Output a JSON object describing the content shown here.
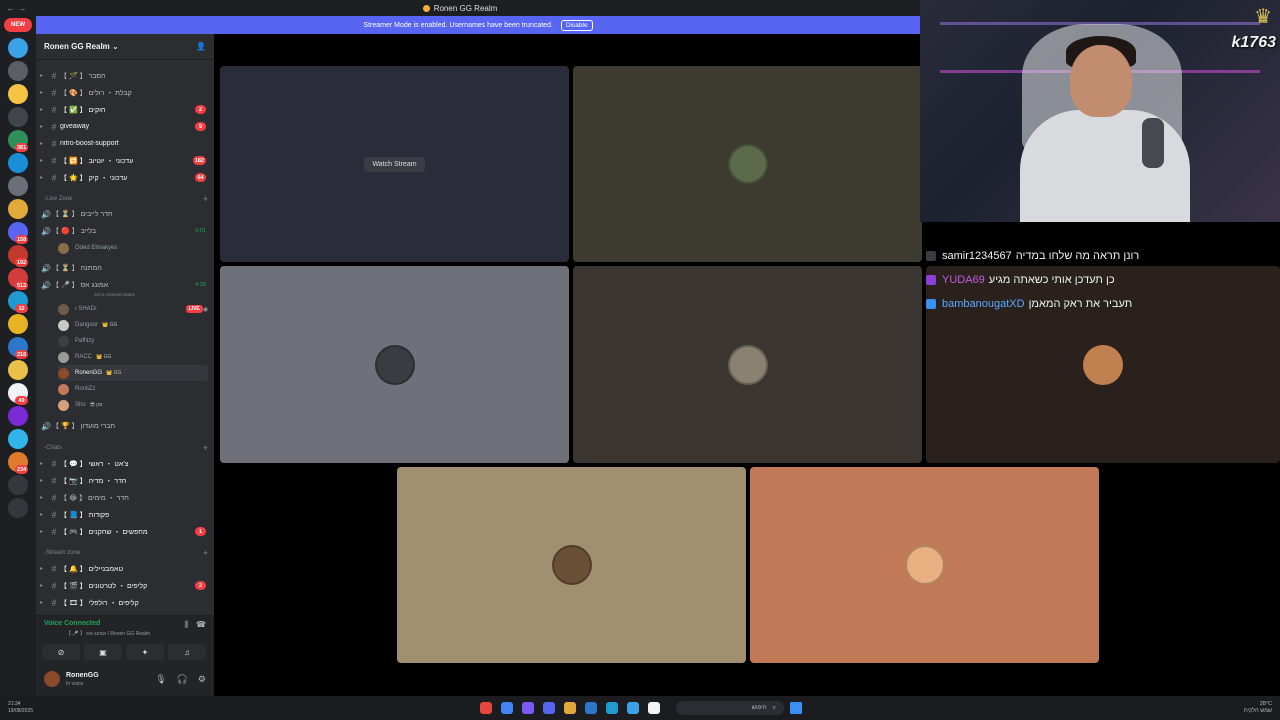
{
  "window": {
    "title": "Ronen GG Realm"
  },
  "banner": {
    "text": "Streamer Mode is enabled. Usernames have been truncated.",
    "action": "Disable"
  },
  "rail": {
    "new_label": "NEW",
    "servers": [
      {
        "color": "#3ba2e8",
        "badge": ""
      },
      {
        "color": "#5b5e66",
        "badge": ""
      },
      {
        "color": "#f4c542",
        "badge": ""
      },
      {
        "color": "#40444b",
        "badge": ""
      },
      {
        "color": "#2f8f5a",
        "badge": "381"
      },
      {
        "color": "#1a8fd6",
        "badge": ""
      },
      {
        "color": "#6b6f78",
        "badge": ""
      },
      {
        "color": "#e0a93a",
        "badge": ""
      },
      {
        "color": "#5865f2",
        "badge": "158"
      },
      {
        "color": "#c0392b",
        "badge": "192"
      },
      {
        "color": "#d23c3c",
        "badge": "513"
      },
      {
        "color": "#1f9bd1",
        "badge": "32"
      },
      {
        "color": "#e6b422",
        "badge": ""
      },
      {
        "color": "#2b77c9",
        "badge": "218"
      },
      {
        "color": "#e8c04a",
        "badge": ""
      },
      {
        "color": "#f2f3f5",
        "badge": "49"
      },
      {
        "color": "#7a2bd6",
        "badge": ""
      },
      {
        "color": "#31b5e8",
        "badge": ""
      },
      {
        "color": "#e07b2e",
        "badge": "234"
      },
      {
        "color": "#35373c",
        "badge": ""
      },
      {
        "color": "#35373c",
        "badge": ""
      }
    ]
  },
  "sidebar": {
    "server_name": "Ronen GG Realm",
    "channels_top": [
      {
        "label": "【 🪄 】 הסבר",
        "badge": ""
      },
      {
        "label": "【 🎨 】 קבלת ・ רולים",
        "badge": ""
      },
      {
        "label": "【 ✅ 】 חוקים",
        "badge": "2"
      },
      {
        "label": "giveaway",
        "badge": "9"
      },
      {
        "label": "nitro-boost-support",
        "badge": ""
      },
      {
        "label": "【 🔁 】 עדכוני ・ יוטיוב",
        "badge": "182"
      },
      {
        "label": "【 🌟 】 עדכוני ・ קיק",
        "badge": "64"
      }
    ],
    "live_zone": {
      "category": "Live Zone",
      "voice_channels": [
        {
          "label": "【 ⏳ 】 חדר לייבים",
          "time": ""
        },
        {
          "label": "【 🔴 】 בלייב",
          "time": "0:01"
        },
        {
          "label": "【 ⏳ 】 המתנה",
          "time": ""
        },
        {
          "label": "【 🎤 】 אמונג אס",
          "time": "4:28"
        },
        {
          "label": "【 🏆 】 חברי מועדון",
          "time": ""
        }
      ],
      "single_member": {
        "name": "Oded Elmakyes",
        "color": "#8b6b4a"
      },
      "status_hint": "Set a channel status",
      "live_label": "LIVE",
      "members": [
        {
          "name": "ı SHADı",
          "tag": "",
          "color": "#6f5b4a",
          "live": true
        },
        {
          "name": "Dangoor",
          "tag": "👑 GG",
          "color": "#c9c9c9",
          "live": false
        },
        {
          "name": "PafNzy",
          "tag": "",
          "color": "#3d3f45",
          "live": false
        },
        {
          "name": "RACC",
          "tag": "👑 GG",
          "color": "#9a9a9a",
          "live": false
        },
        {
          "name": "RonenGG",
          "tag": "👑 GG",
          "color": "#8b4a2a",
          "live": false
        },
        {
          "name": "RonliZz",
          "tag": "",
          "color": "#c27a5a",
          "live": false
        },
        {
          "name": "Sho",
          "tag": "😎 זמן",
          "color": "#d6a07a",
          "live": false
        }
      ]
    },
    "chats": {
      "category": "Chats",
      "channels": [
        {
          "label": "【 💬 】 צ'אט ・ ראשי",
          "badge": ""
        },
        {
          "label": "【 📷 】 חדר ・ מדיה",
          "badge": ""
        },
        {
          "label": "【 😂 】 חדר ・ מימים",
          "badge": ""
        },
        {
          "label": "【 📘 】 פקודות",
          "badge": ""
        },
        {
          "label": "【 🎮 】 מחפשים ・ שחקנים",
          "badge": "1"
        }
      ]
    },
    "stream_zone": {
      "category": "Stream zone",
      "channels": [
        {
          "label": "【 🔔 】 טאמבניילים",
          "badge": ""
        },
        {
          "label": "【 🎬 】 קליפים ・ לטרטונים",
          "badge": "2"
        },
        {
          "label": "【 🎞 】 קליפים ・ רולפלי",
          "badge": ""
        }
      ]
    },
    "voice_panel": {
      "status": "Voice Connected",
      "sub": "【 🎤 】 אמונג אס / Ronen GG Realm"
    },
    "user": {
      "name": "RonenGG",
      "status": "In voice"
    }
  },
  "call": {
    "watch_label": "Watch Stream",
    "tiles": [
      {
        "bg": "#2a2c3a",
        "avatar": "",
        "stream": true
      },
      {
        "bg": "#3d3a30",
        "avatar": "#5a6a4a"
      },
      {
        "bg": "#6e717a",
        "avatar": "#3a3c44"
      },
      {
        "bg": "#3a3530",
        "avatar": "#8a8070"
      },
      {
        "bg": "#2a211c",
        "avatar": "#c08050"
      },
      {
        "bg": "#a0906f",
        "avatar": "#6b5038"
      },
      {
        "bg": "#c07a58",
        "avatar": "#e8b080"
      }
    ]
  },
  "cam": {
    "streamer_id": "k1763"
  },
  "chat_overlay": {
    "messages": [
      {
        "name": "samir1234567",
        "text": "רונן תראה מה שלחו במדיה",
        "name_color": "#f2f3f5",
        "icon": "#3a3c44"
      },
      {
        "name": "YUDA69",
        "text": "כן תעדכן אותי כשאתה מגיע",
        "name_color": "#c45ce0",
        "icon": "#8a3fd6"
      },
      {
        "name": "bambanougatXD",
        "text": "תעביר את ראק המאמן",
        "name_color": "#5aa9ff",
        "icon": "#3b8ff0"
      }
    ]
  },
  "taskbar": {
    "time": "21:34",
    "date": "19/08/2025",
    "search_placeholder": "חיפוש",
    "weather": "28°C",
    "weather_text": "שמש חלקית",
    "apps": [
      "#e8453c",
      "#4285f4",
      "#7a5af8",
      "#5865f2",
      "#e0a93a",
      "#2b77c9",
      "#1f9bd1",
      "#3ba2e8",
      "#f2f3f5"
    ]
  }
}
